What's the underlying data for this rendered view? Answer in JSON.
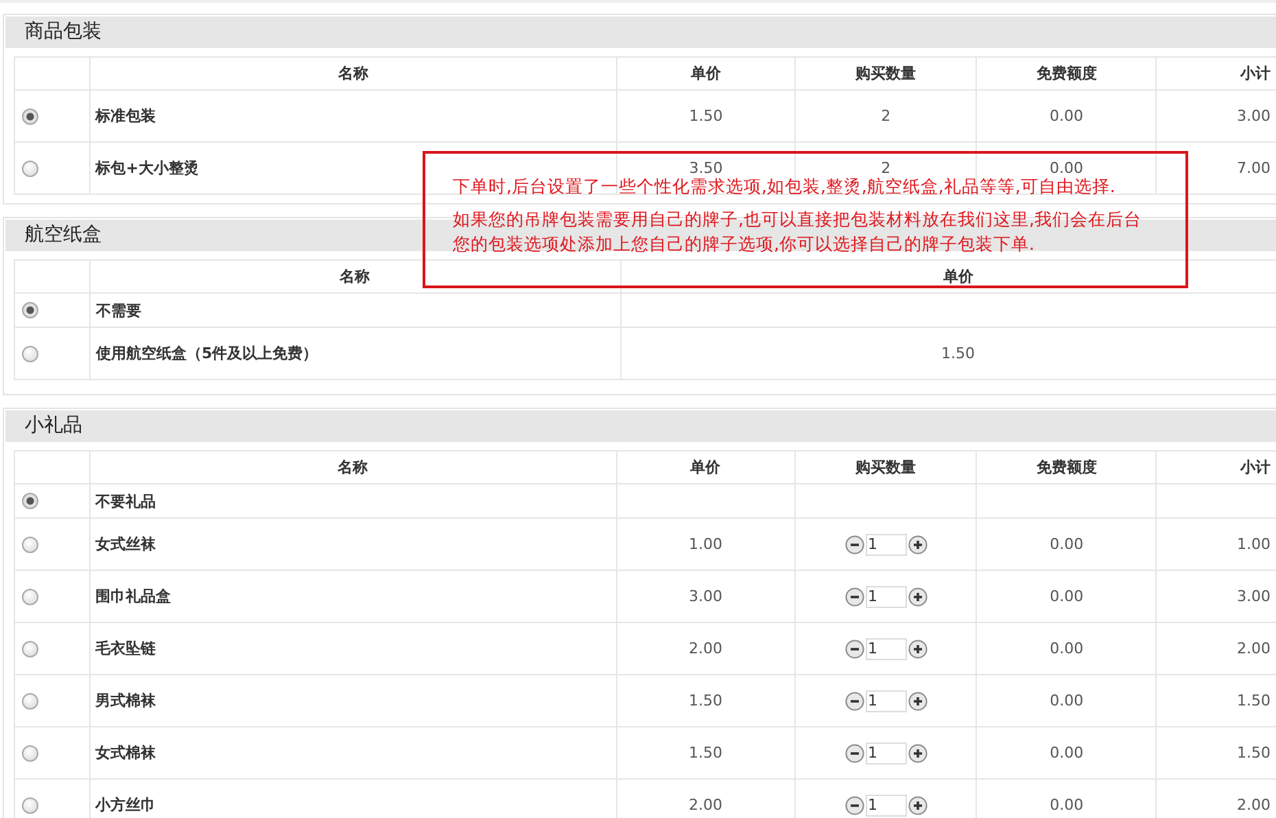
{
  "sections": [
    {
      "title": "商品包装",
      "columns": [
        "名称",
        "单价",
        "购买数量",
        "免费额度",
        "小计"
      ],
      "rows": [
        {
          "selected": true,
          "name": "标准包装",
          "price": "1.50",
          "quantity": {
            "kind": "text",
            "value": "2"
          },
          "free": "0.00",
          "subtotal": "3.00"
        },
        {
          "selected": false,
          "name": "标包+大小整烫",
          "price": "3.50",
          "quantity": {
            "kind": "text",
            "value": "2"
          },
          "free": "0.00",
          "subtotal": "7.00"
        }
      ]
    },
    {
      "title": "航空纸盒",
      "columns": [
        "名称",
        "单价"
      ],
      "rows": [
        {
          "selected": true,
          "name": "不需要"
        },
        {
          "selected": false,
          "name": "使用航空纸盒（5件及以上免费）",
          "price": "1.50"
        }
      ]
    },
    {
      "title": "小礼品",
      "columns": [
        "名称",
        "单价",
        "购买数量",
        "免费额度",
        "小计"
      ],
      "rows": [
        {
          "selected": true,
          "name": "不要礼品"
        },
        {
          "selected": false,
          "name": "女式丝袜",
          "price": "1.00",
          "quantity": {
            "kind": "stepper",
            "value": "1"
          },
          "free": "0.00",
          "subtotal": "1.00"
        },
        {
          "selected": false,
          "name": "围巾礼品盒",
          "price": "3.00",
          "quantity": {
            "kind": "stepper",
            "value": "1"
          },
          "free": "0.00",
          "subtotal": "3.00"
        },
        {
          "selected": false,
          "name": "毛衣坠链",
          "price": "2.00",
          "quantity": {
            "kind": "stepper",
            "value": "1"
          },
          "free": "0.00",
          "subtotal": "2.00"
        },
        {
          "selected": false,
          "name": "男式棉袜",
          "price": "1.50",
          "quantity": {
            "kind": "stepper",
            "value": "1"
          },
          "free": "0.00",
          "subtotal": "1.50"
        },
        {
          "selected": false,
          "name": "女式棉袜",
          "price": "1.50",
          "quantity": {
            "kind": "stepper",
            "value": "1"
          },
          "free": "0.00",
          "subtotal": "1.50"
        },
        {
          "selected": false,
          "name": "小方丝巾",
          "price": "2.00",
          "quantity": {
            "kind": "stepper",
            "value": "1"
          },
          "free": "0.00",
          "subtotal": "2.00"
        }
      ]
    }
  ],
  "callout": {
    "paragraphs": [
      "下单时,后台设置了一些个性化需求选项,如包装,整烫,航空纸盒,礼品等等,可自由选择.",
      "如果您的吊牌包装需要用自己的牌子,也可以直接把包装材料放在我们这里,我们会在后台您的包装选项处添加上您自己的牌子选项,你可以选择自己的牌子包装下单."
    ]
  }
}
